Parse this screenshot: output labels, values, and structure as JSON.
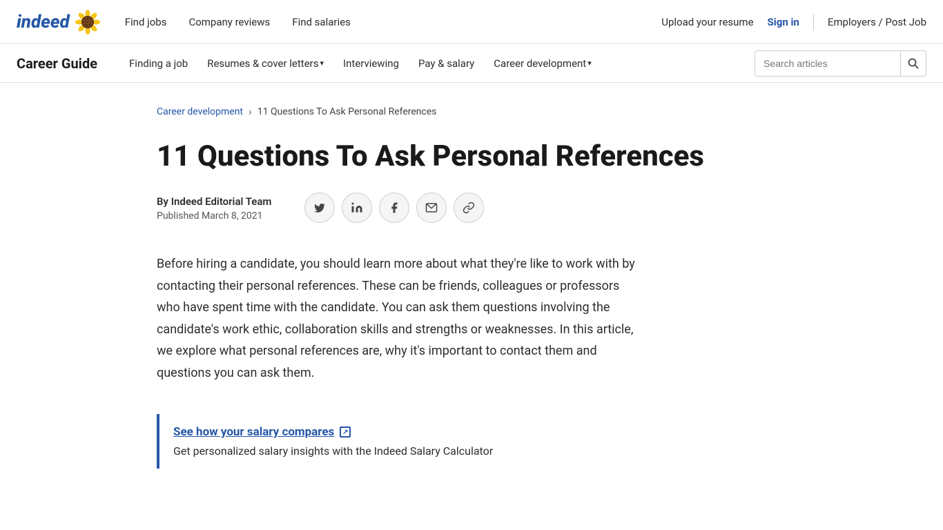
{
  "topNav": {
    "logo": "indeed",
    "links": [
      {
        "label": "Find jobs",
        "href": "#"
      },
      {
        "label": "Company reviews",
        "href": "#"
      },
      {
        "label": "Find salaries",
        "href": "#"
      }
    ],
    "right": {
      "upload": "Upload your resume",
      "signIn": "Sign in",
      "employers": "Employers / Post Job"
    }
  },
  "secondaryNav": {
    "title": "Career Guide",
    "links": [
      {
        "label": "Finding a job",
        "hasDropdown": false
      },
      {
        "label": "Resumes & cover letters",
        "hasDropdown": true
      },
      {
        "label": "Interviewing",
        "hasDropdown": false
      },
      {
        "label": "Pay & salary",
        "hasDropdown": false
      },
      {
        "label": "Career development",
        "hasDropdown": true
      }
    ],
    "search": {
      "placeholder": "Search articles"
    }
  },
  "breadcrumb": {
    "parent": "Career development",
    "current": "11 Questions To Ask Personal References"
  },
  "article": {
    "title": "11 Questions To Ask Personal References",
    "author": "By Indeed Editorial Team",
    "published": "Published March 8, 2021",
    "body": "Before hiring a candidate, you should learn more about what they're like to work with by contacting their personal references. These can be friends, colleagues or professors who have spent time with the candidate. You can ask them questions involving the candidate's work ethic, collaboration skills and strengths or weaknesses. In this article, we explore what personal references are, why it's important to contact them and questions you can ask them."
  },
  "salaryCallout": {
    "link": "See how your salary compares",
    "description": "Get personalized salary insights with the Indeed Salary Calculator"
  },
  "shareButtons": [
    {
      "icon": "🐦",
      "name": "twitter-share-button",
      "title": "Twitter"
    },
    {
      "icon": "in",
      "name": "linkedin-share-button",
      "title": "LinkedIn"
    },
    {
      "icon": "f",
      "name": "facebook-share-button",
      "title": "Facebook"
    },
    {
      "icon": "✉",
      "name": "email-share-button",
      "title": "Email"
    },
    {
      "icon": "🔗",
      "name": "copy-link-share-button",
      "title": "Copy link"
    }
  ]
}
